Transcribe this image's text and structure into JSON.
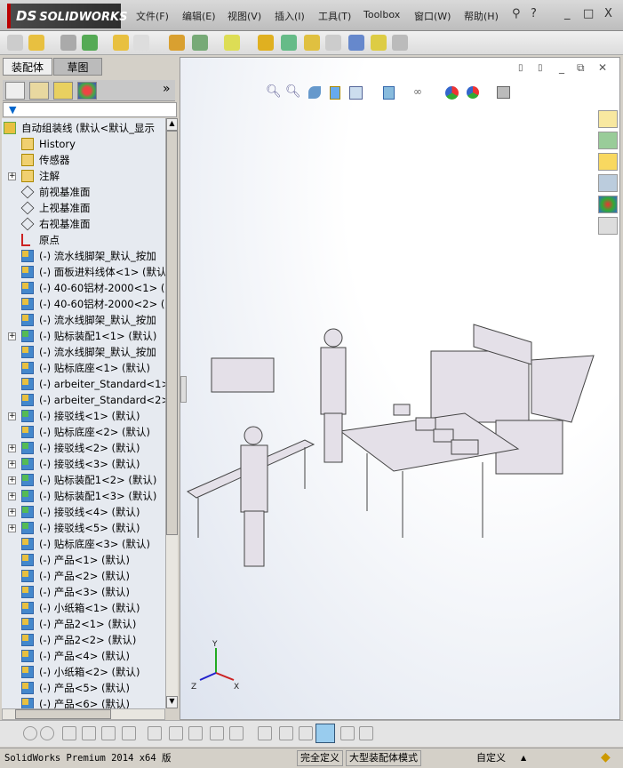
{
  "app": {
    "logo": "SOLIDWORKS",
    "logo_ds": "DS"
  },
  "menu": [
    "文件(F)",
    "编辑(E)",
    "视图(V)",
    "插入(I)",
    "工具(T)",
    "Toolbox",
    "窗口(W)",
    "帮助(H)"
  ],
  "window_controls": {
    "help": "?",
    "minimize": "_",
    "restore": "□",
    "close": "X"
  },
  "panel": {
    "tabs": [
      "装配体",
      "草图"
    ],
    "more": "»"
  },
  "tree": {
    "root": "自动组装线  (默认<默认_显示",
    "items": [
      {
        "label": "History",
        "icon": "history-icon",
        "exp": false
      },
      {
        "label": "传感器",
        "icon": "sensor-icon",
        "exp": false
      },
      {
        "label": "注解",
        "icon": "annotation-icon",
        "exp": true
      },
      {
        "label": "前视基准面",
        "icon": "plane-icon",
        "exp": false
      },
      {
        "label": "上视基准面",
        "icon": "plane-icon",
        "exp": false
      },
      {
        "label": "右视基准面",
        "icon": "plane-icon",
        "exp": false
      },
      {
        "label": "原点",
        "icon": "origin-icon",
        "exp": false
      },
      {
        "label": "(-) 流水线脚架_默认_按加",
        "icon": "part-icon",
        "exp": false
      },
      {
        "label": "(-) 面板进料线体<1> (默认",
        "icon": "part-icon",
        "exp": false
      },
      {
        "label": "(-) 40-60铝材-2000<1> (默",
        "icon": "part-icon",
        "exp": false
      },
      {
        "label": "(-) 40-60铝材-2000<2> (默",
        "icon": "part-icon",
        "exp": false
      },
      {
        "label": "(-) 流水线脚架_默认_按加",
        "icon": "part-icon",
        "exp": false
      },
      {
        "label": "(-) 贴标装配1<1> (默认)",
        "icon": "assembly-icon",
        "exp": true
      },
      {
        "label": "(-) 流水线脚架_默认_按加",
        "icon": "part-icon",
        "exp": false
      },
      {
        "label": "(-) 贴标底座<1> (默认)",
        "icon": "part-icon",
        "exp": false
      },
      {
        "label": "(-) arbeiter_Standard<1>",
        "icon": "part-icon",
        "exp": false
      },
      {
        "label": "(-) arbeiter_Standard<2>",
        "icon": "part-icon",
        "exp": false
      },
      {
        "label": "(-) 接驳线<1> (默认)",
        "icon": "assembly-icon",
        "exp": true
      },
      {
        "label": "(-) 贴标底座<2> (默认)",
        "icon": "part-icon",
        "exp": false
      },
      {
        "label": "(-) 接驳线<2> (默认)",
        "icon": "assembly-icon",
        "exp": true
      },
      {
        "label": "(-) 接驳线<3> (默认)",
        "icon": "assembly-icon",
        "exp": true
      },
      {
        "label": "(-) 贴标装配1<2> (默认)",
        "icon": "assembly-icon",
        "exp": true
      },
      {
        "label": "(-) 贴标装配1<3> (默认)",
        "icon": "assembly-icon",
        "exp": true
      },
      {
        "label": "(-) 接驳线<4> (默认)",
        "icon": "assembly-icon",
        "exp": true
      },
      {
        "label": "(-) 接驳线<5> (默认)",
        "icon": "assembly-icon",
        "exp": true
      },
      {
        "label": "(-) 贴标底座<3> (默认)",
        "icon": "part-icon",
        "exp": false
      },
      {
        "label": "(-) 产品<1> (默认)",
        "icon": "part-icon",
        "exp": false
      },
      {
        "label": "(-) 产品<2> (默认)",
        "icon": "part-icon",
        "exp": false
      },
      {
        "label": "(-) 产品<3> (默认)",
        "icon": "part-icon",
        "exp": false
      },
      {
        "label": "(-) 小纸箱<1> (默认)",
        "icon": "part-icon",
        "exp": false
      },
      {
        "label": "(-) 产品2<1> (默认)",
        "icon": "part-icon",
        "exp": false
      },
      {
        "label": "(-) 产品2<2> (默认)",
        "icon": "part-icon",
        "exp": false
      },
      {
        "label": "(-) 产品<4> (默认)",
        "icon": "part-icon",
        "exp": false
      },
      {
        "label": "(-) 小纸箱<2> (默认)",
        "icon": "part-icon",
        "exp": false
      },
      {
        "label": "(-) 产品<5> (默认)",
        "icon": "part-icon",
        "exp": false
      },
      {
        "label": "(-) 产品<6> (默认)",
        "icon": "part-icon",
        "exp": false
      }
    ]
  },
  "triad": {
    "x": "X",
    "y": "Y",
    "z": "Z"
  },
  "status": {
    "product": "SolidWorks Premium 2014 x64 版",
    "defined": "完全定义",
    "mode": "大型装配体模式",
    "units": "自定义",
    "arrow": "▲"
  }
}
